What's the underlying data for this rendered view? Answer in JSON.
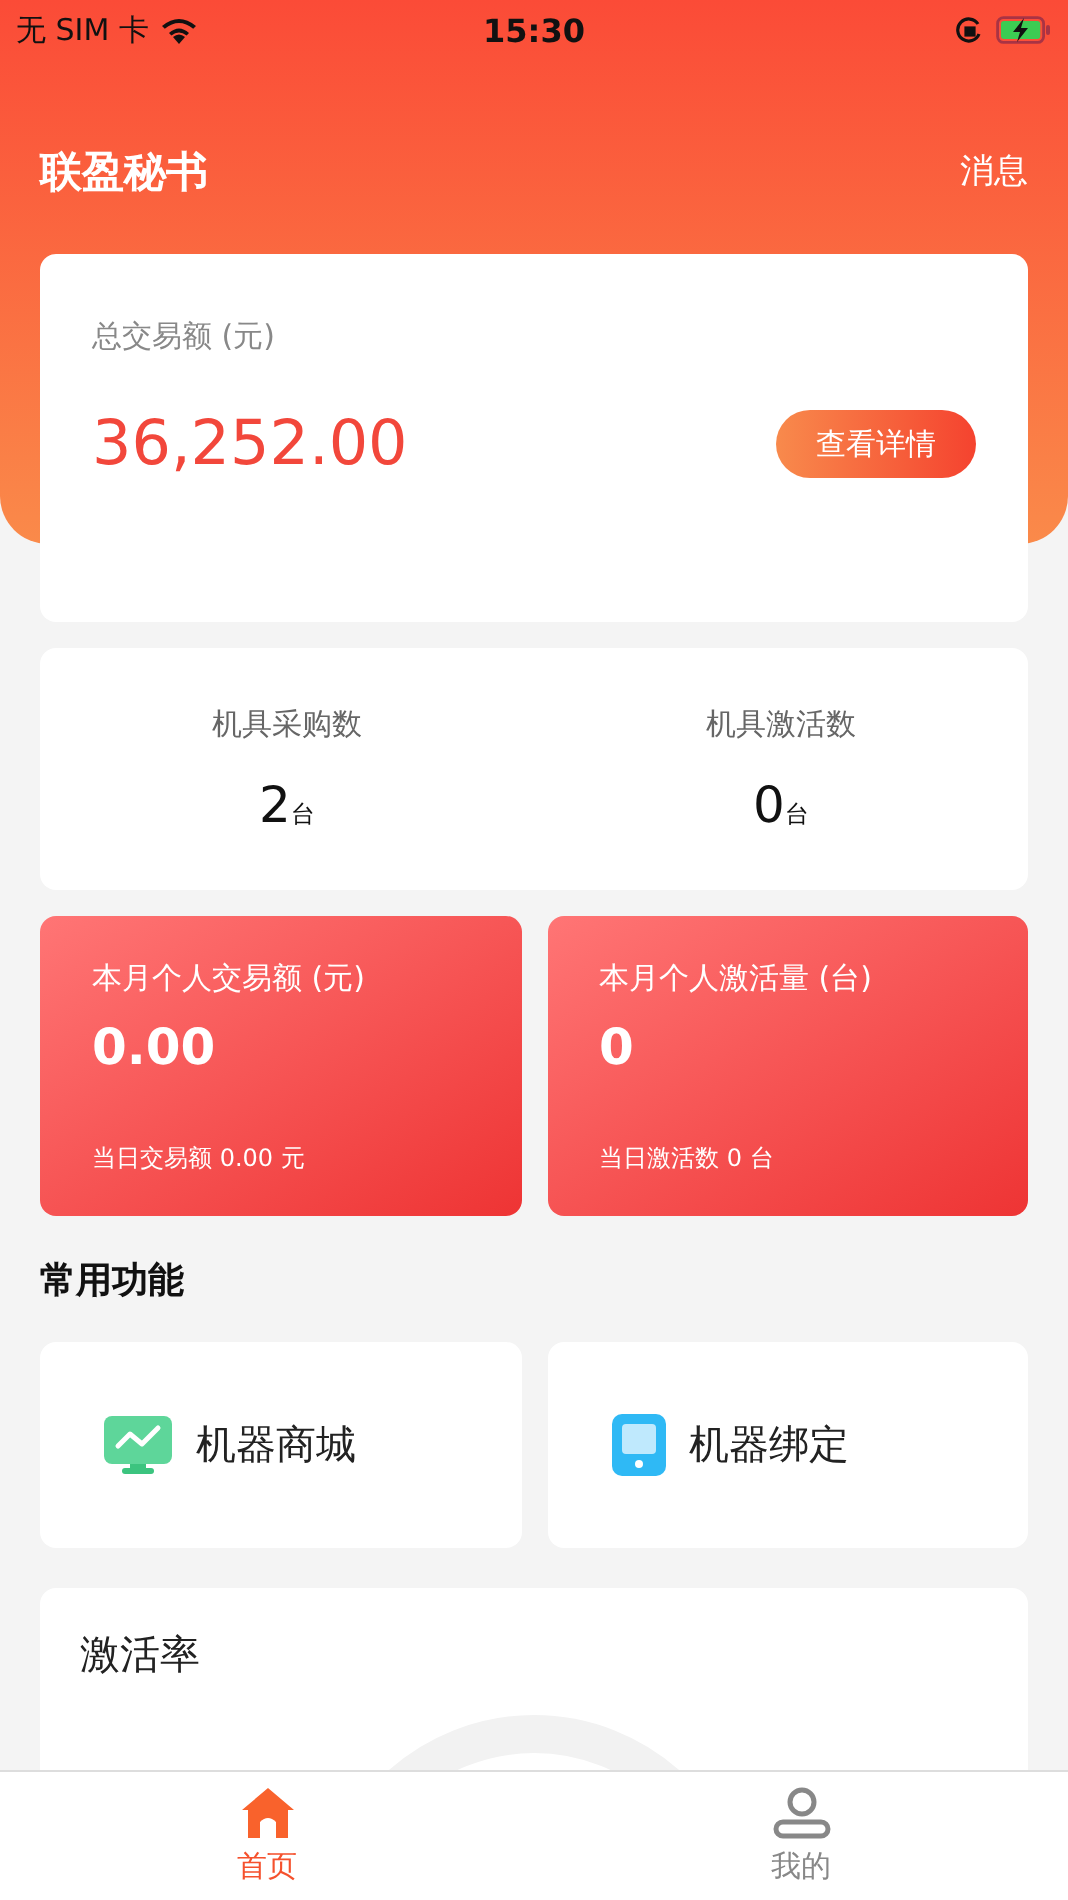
{
  "status_bar": {
    "carrier": "无 SIM 卡",
    "time": "15:30"
  },
  "header": {
    "title": "联盈秘书",
    "action": "消息"
  },
  "total": {
    "label": "总交易额 (元)",
    "amount": "36,252.00",
    "button": "查看详情"
  },
  "machines": [
    {
      "label": "机具采购数",
      "value": "2",
      "unit": "台"
    },
    {
      "label": "机具激活数",
      "value": "0",
      "unit": "台"
    }
  ],
  "monthly": [
    {
      "label": "本月个人交易额 (元)",
      "value": "0.00",
      "note": "当日交易额 0.00 元"
    },
    {
      "label": "本月个人激活量 (台)",
      "value": "0",
      "note": "当日激活数 0 台"
    }
  ],
  "functions": {
    "title": "常用功能",
    "items": [
      {
        "label": "机器商城",
        "kind": "monitor"
      },
      {
        "label": "机器绑定",
        "kind": "tablet"
      }
    ]
  },
  "activation": {
    "title": "激活率"
  },
  "tab_bar": [
    {
      "label": "首页",
      "kind": "home",
      "selected": true
    },
    {
      "label": "我的",
      "kind": "profile",
      "selected": false
    }
  ]
}
